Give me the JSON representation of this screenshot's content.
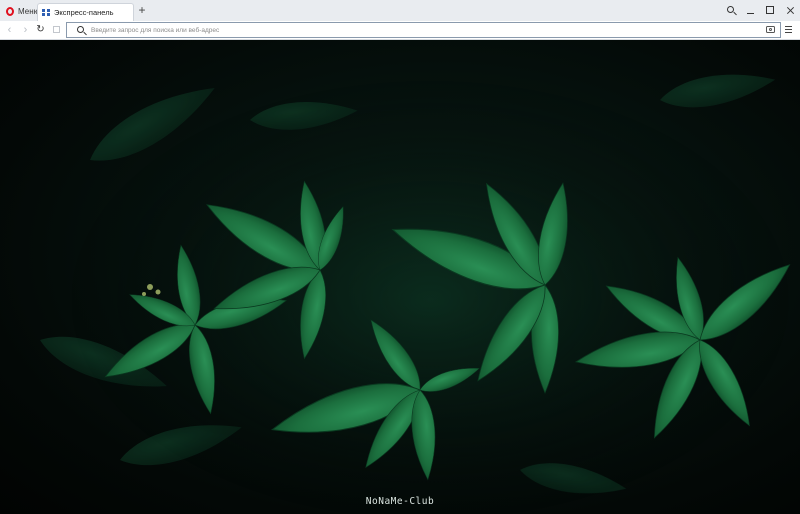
{
  "browser": {
    "menu_label": "Меню",
    "tab": {
      "title": "Экспресс-панель",
      "icon": "speed-dial-grid-icon"
    },
    "new_tab_label": "+",
    "window_controls": [
      "search-tabs-icon",
      "minimize-icon",
      "maximize-icon",
      "close-icon"
    ]
  },
  "toolbar": {
    "back_icon": "‹",
    "forward_icon": "›",
    "reload_icon": "↻",
    "address_placeholder": "Введите запрос для поиска или веб-адрес",
    "address_value": ""
  },
  "content": {
    "background": "dark green leaves wallpaper",
    "watermark": "NoNaMe-Club"
  },
  "colors": {
    "tabbar_bg": "#e9ecf0",
    "opera_red": "#e0101e",
    "speed_dial_blue": "#2f5fb3",
    "leaf_green": "#1f7a46",
    "background": "#030806"
  }
}
